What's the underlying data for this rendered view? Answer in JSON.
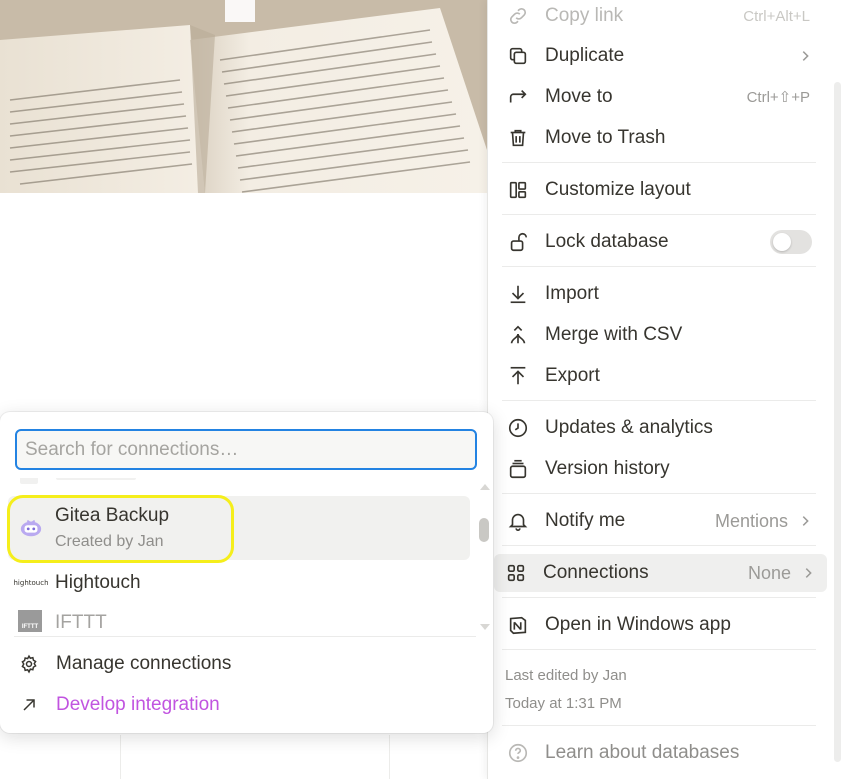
{
  "menu": {
    "items": [
      {
        "label": "Copy link",
        "shortcut": "Ctrl+Alt+L",
        "icon": "link-icon"
      },
      {
        "label": "Duplicate",
        "icon": "duplicate-icon"
      },
      {
        "label": "Move to",
        "shortcut": "Ctrl+⇧+P",
        "icon": "move-arrow-icon"
      },
      {
        "label": "Move to Trash",
        "icon": "trash-icon"
      },
      {
        "label": "Customize layout",
        "icon": "layout-icon"
      },
      {
        "label": "Lock database",
        "icon": "lock-open-icon",
        "toggle": false
      },
      {
        "label": "Import",
        "icon": "import-icon"
      },
      {
        "label": "Merge with CSV",
        "icon": "merge-icon"
      },
      {
        "label": "Export",
        "icon": "export-icon"
      },
      {
        "label": "Updates & analytics",
        "icon": "clock-icon"
      },
      {
        "label": "Version history",
        "icon": "version-history-icon"
      },
      {
        "label": "Notify me",
        "value": "Mentions",
        "icon": "bell-icon"
      },
      {
        "label": "Connections",
        "value": "None",
        "icon": "connections-grid-icon"
      },
      {
        "label": "Open in Windows app",
        "icon": "notion-app-icon"
      },
      {
        "label": "Learn about databases",
        "icon": "help-icon"
      }
    ],
    "last_edited_by": "Last edited by Jan",
    "last_edited_time": "Today at 1:31 PM"
  },
  "connections_popup": {
    "search_placeholder": "Search for connections…",
    "list": [
      {
        "name": "Gitea Backup",
        "subtitle": "Created by Jan",
        "icon": "gitea-logo-icon"
      },
      {
        "name": "Hightouch",
        "logo_text": "hightouch",
        "icon": "hightouch-logo-icon"
      },
      {
        "name": "IFTTT",
        "logo_text": "IFTTT",
        "icon": "ifttt-logo-icon"
      }
    ],
    "footer": {
      "manage": "Manage connections",
      "develop": "Develop integration"
    }
  },
  "colors": {
    "accent_purple": "#c154e0",
    "focus_blue": "#2383e2",
    "annotation_yellow": "#f5ee1b"
  }
}
